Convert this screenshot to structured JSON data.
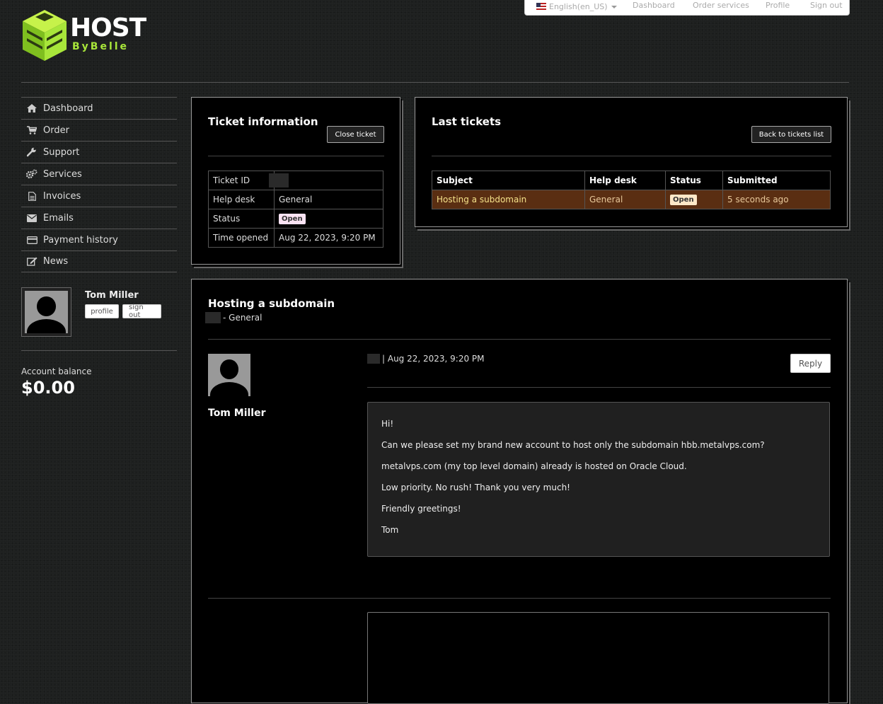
{
  "logo": {
    "word1": "HOST",
    "word2": "ByBelle"
  },
  "topnav": {
    "language": "English(en_US)",
    "links": [
      "Dashboard",
      "Order services",
      "Profile",
      "Sign out"
    ]
  },
  "sidebar": {
    "items": [
      {
        "label": "Dashboard",
        "icon": "home-icon"
      },
      {
        "label": "Order",
        "icon": "cart-icon"
      },
      {
        "label": "Support",
        "icon": "wrench-icon"
      },
      {
        "label": "Services",
        "icon": "gears-icon"
      },
      {
        "label": "Invoices",
        "icon": "document-icon"
      },
      {
        "label": "Emails",
        "icon": "envelope-icon"
      },
      {
        "label": "Payment history",
        "icon": "credit-card-icon"
      },
      {
        "label": "News",
        "icon": "edit-icon"
      }
    ]
  },
  "profile": {
    "name": "Tom Miller",
    "profile_btn": "profile",
    "signout_btn": "sign out"
  },
  "account": {
    "label": "Account balance",
    "value": "$0.00"
  },
  "ticket_info": {
    "title": "Ticket information",
    "close_btn": "Close ticket",
    "rows": [
      {
        "label": "Ticket ID",
        "value": ""
      },
      {
        "label": "Help desk",
        "value": "General"
      },
      {
        "label": "Status",
        "value": "Open"
      },
      {
        "label": "Time opened",
        "value": "Aug 22, 2023, 9:20 PM"
      }
    ]
  },
  "last_tickets": {
    "title": "Last tickets",
    "back_btn": "Back to tickets list",
    "headers": [
      "Subject",
      "Help desk",
      "Status",
      "Submitted"
    ],
    "rows": [
      {
        "subject": "Hosting a subdomain",
        "helpdesk": "General",
        "status": "Open",
        "submitted": "5 seconds ago"
      }
    ]
  },
  "ticket": {
    "subject": "Hosting a subdomain",
    "subline": "- General",
    "author": "Tom Miller",
    "meta": "| Aug 22, 2023, 9:20 PM",
    "reply_btn": "Reply",
    "message": [
      "Hi!",
      "Can we please set my brand new account to host only the subdomain hbb.metalvps.com?",
      "metalvps.com (my top level domain) already is hosted on Oracle Cloud.",
      "Low priority. No rush! Thank you very much!",
      "Friendly greetings!",
      "Tom"
    ]
  },
  "colors": {
    "accent": "#a8e63a",
    "highlight_row": "#5a2e12",
    "badge": "#fbe3f3"
  }
}
